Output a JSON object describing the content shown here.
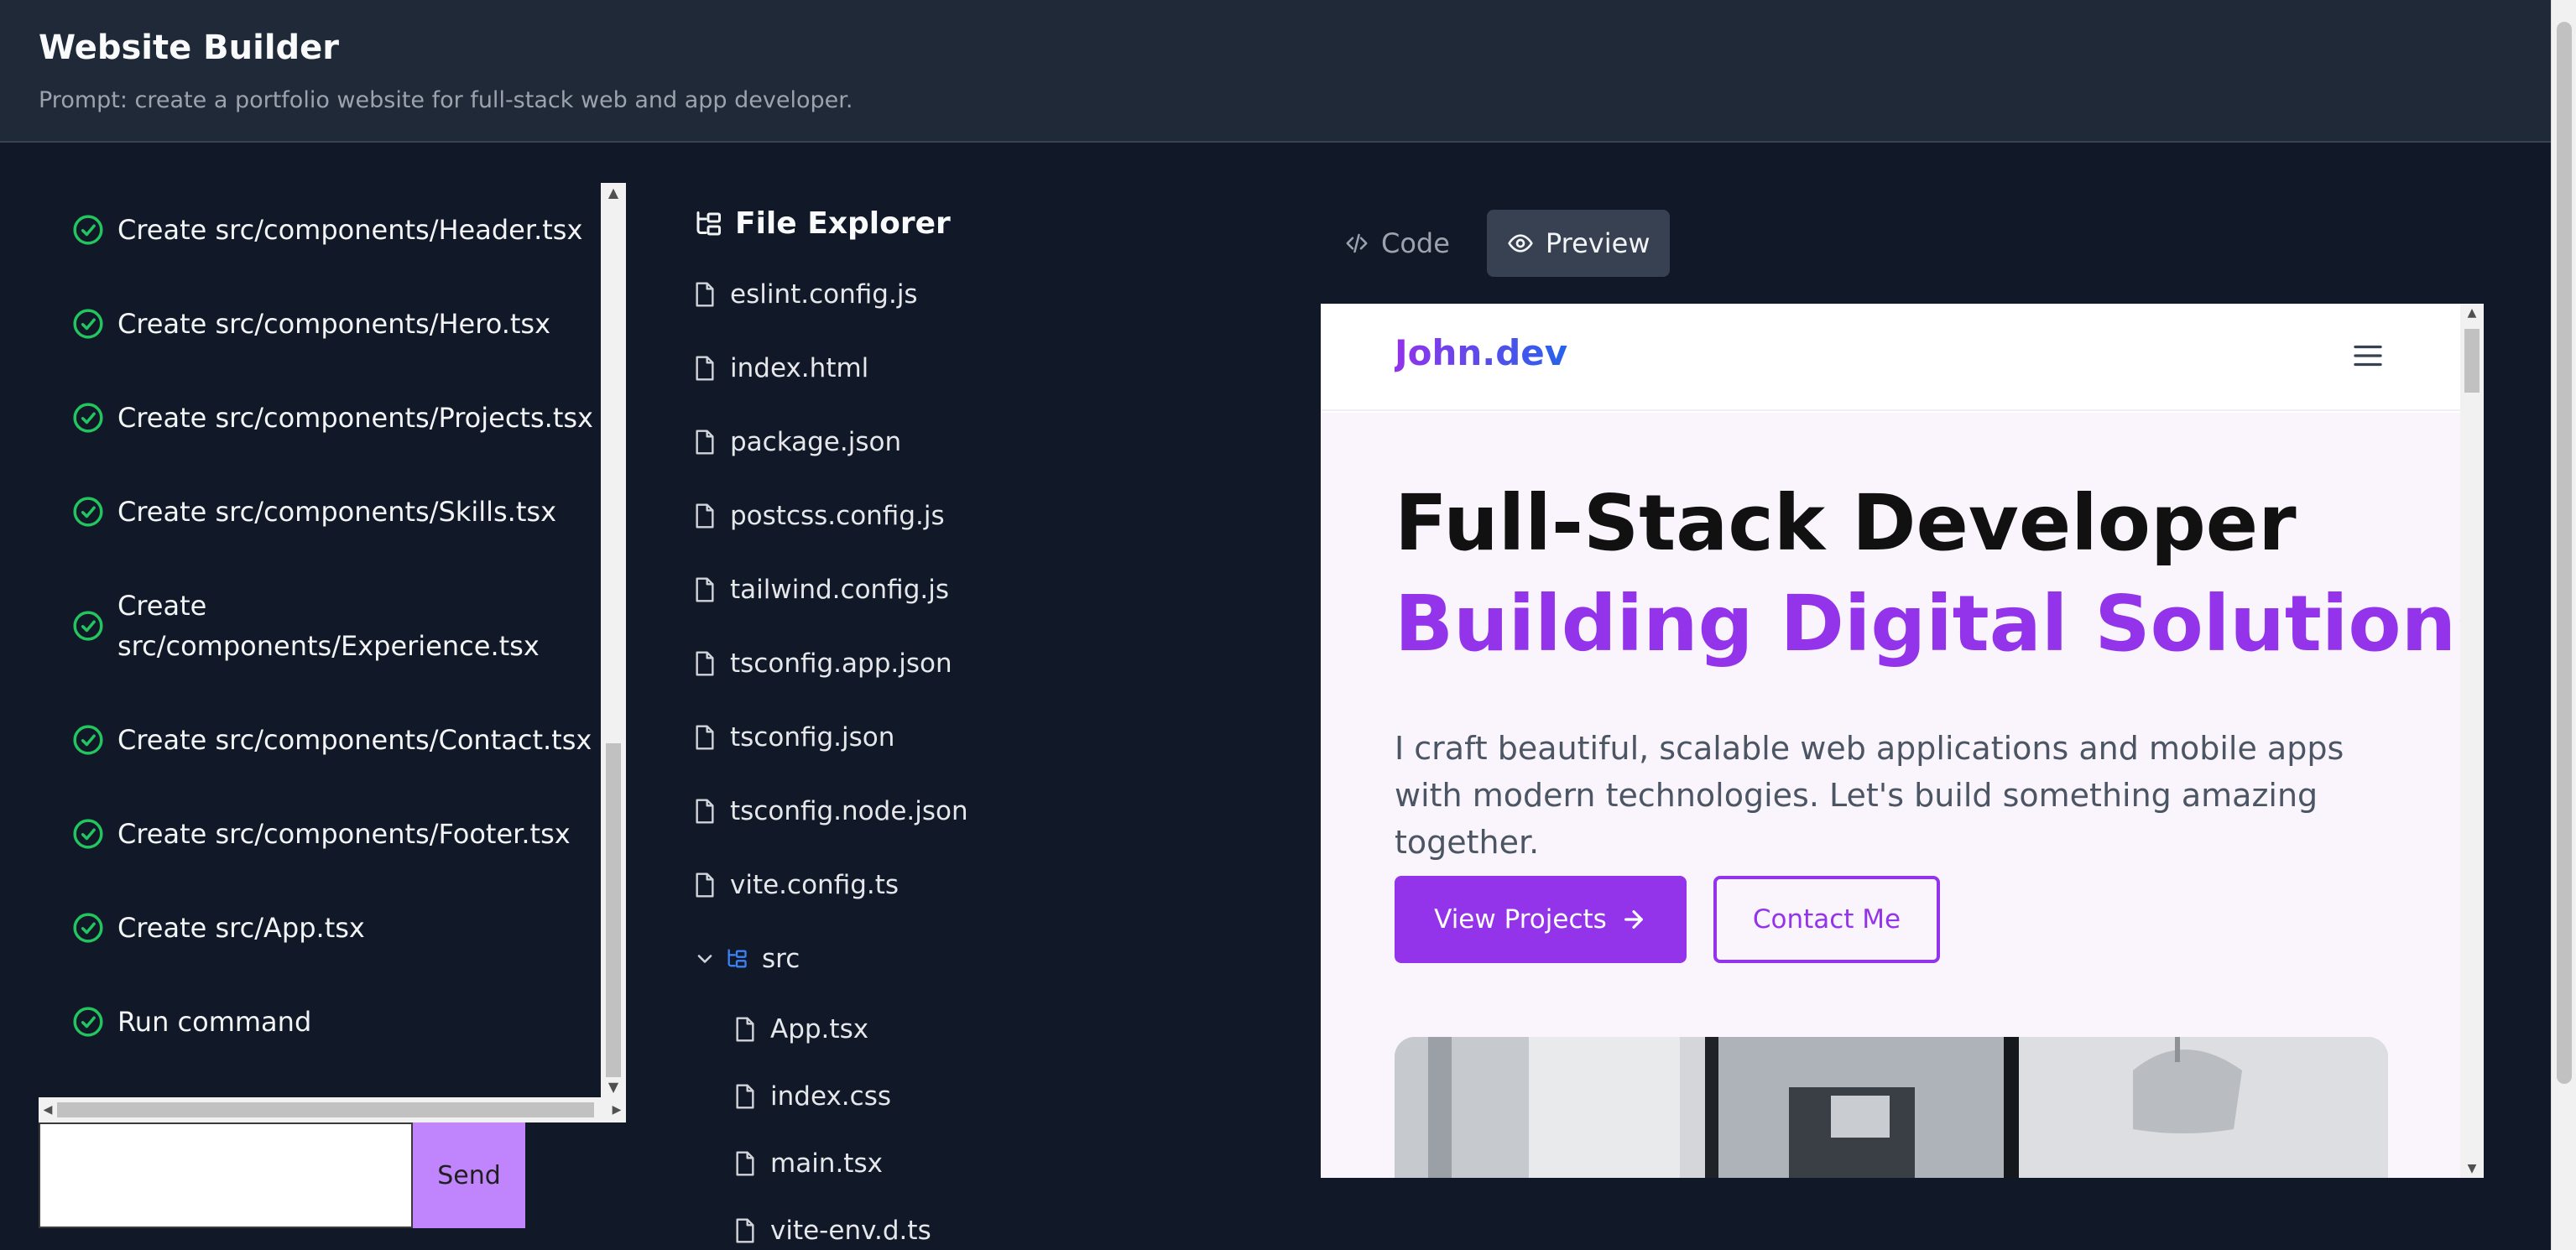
{
  "header": {
    "title": "Website Builder",
    "prompt": "Prompt: create a portfolio website for full-stack web and app developer."
  },
  "steps": [
    {
      "label": "Create src/components/Header.tsx",
      "status": "done"
    },
    {
      "label": "Create src/components/Hero.tsx",
      "status": "done"
    },
    {
      "label": "Create src/components/Projects.tsx",
      "status": "done"
    },
    {
      "label": "Create src/components/Skills.tsx",
      "status": "done"
    },
    {
      "label": "Create src/components/Experience.tsx",
      "status": "done"
    },
    {
      "label": "Create src/components/Contact.tsx",
      "status": "done"
    },
    {
      "label": "Create src/components/Footer.tsx",
      "status": "done"
    },
    {
      "label": "Create src/App.tsx",
      "status": "done"
    },
    {
      "label": "Run command",
      "status": "done"
    }
  ],
  "chat": {
    "input_value": "",
    "send_label": "Send"
  },
  "explorer": {
    "title": "File Explorer",
    "files": [
      "eslint.config.js",
      "index.html",
      "package.json",
      "postcss.config.js",
      "tailwind.config.js",
      "tsconfig.app.json",
      "tsconfig.json",
      "tsconfig.node.json",
      "vite.config.ts"
    ],
    "folder": {
      "name": "src",
      "expanded": true,
      "children": [
        "App.tsx",
        "index.css",
        "main.tsx",
        "vite-env.d.ts"
      ]
    }
  },
  "tabs": [
    {
      "label": "Code",
      "icon": "code-icon",
      "active": false
    },
    {
      "label": "Preview",
      "icon": "eye-icon",
      "active": true
    }
  ],
  "preview": {
    "logo": "John.dev",
    "headline_line1": "Full-Stack Developer",
    "headline_line2": "Building Digital Solutions",
    "description": "I craft beautiful, scalable web applications and mobile apps with modern technologies. Let's build something amazing together.",
    "primary_button": "View Projects",
    "secondary_button": "Contact Me",
    "colors": {
      "accent": "#9333ea",
      "logo_end": "#2563eb",
      "hero_bg": "#faf5fc"
    }
  },
  "colors": {
    "page_bg": "#111827",
    "header_bg": "#1f2937",
    "check": "#22c55e",
    "send_bg": "#c084fc",
    "tab_active_bg": "#374151"
  }
}
